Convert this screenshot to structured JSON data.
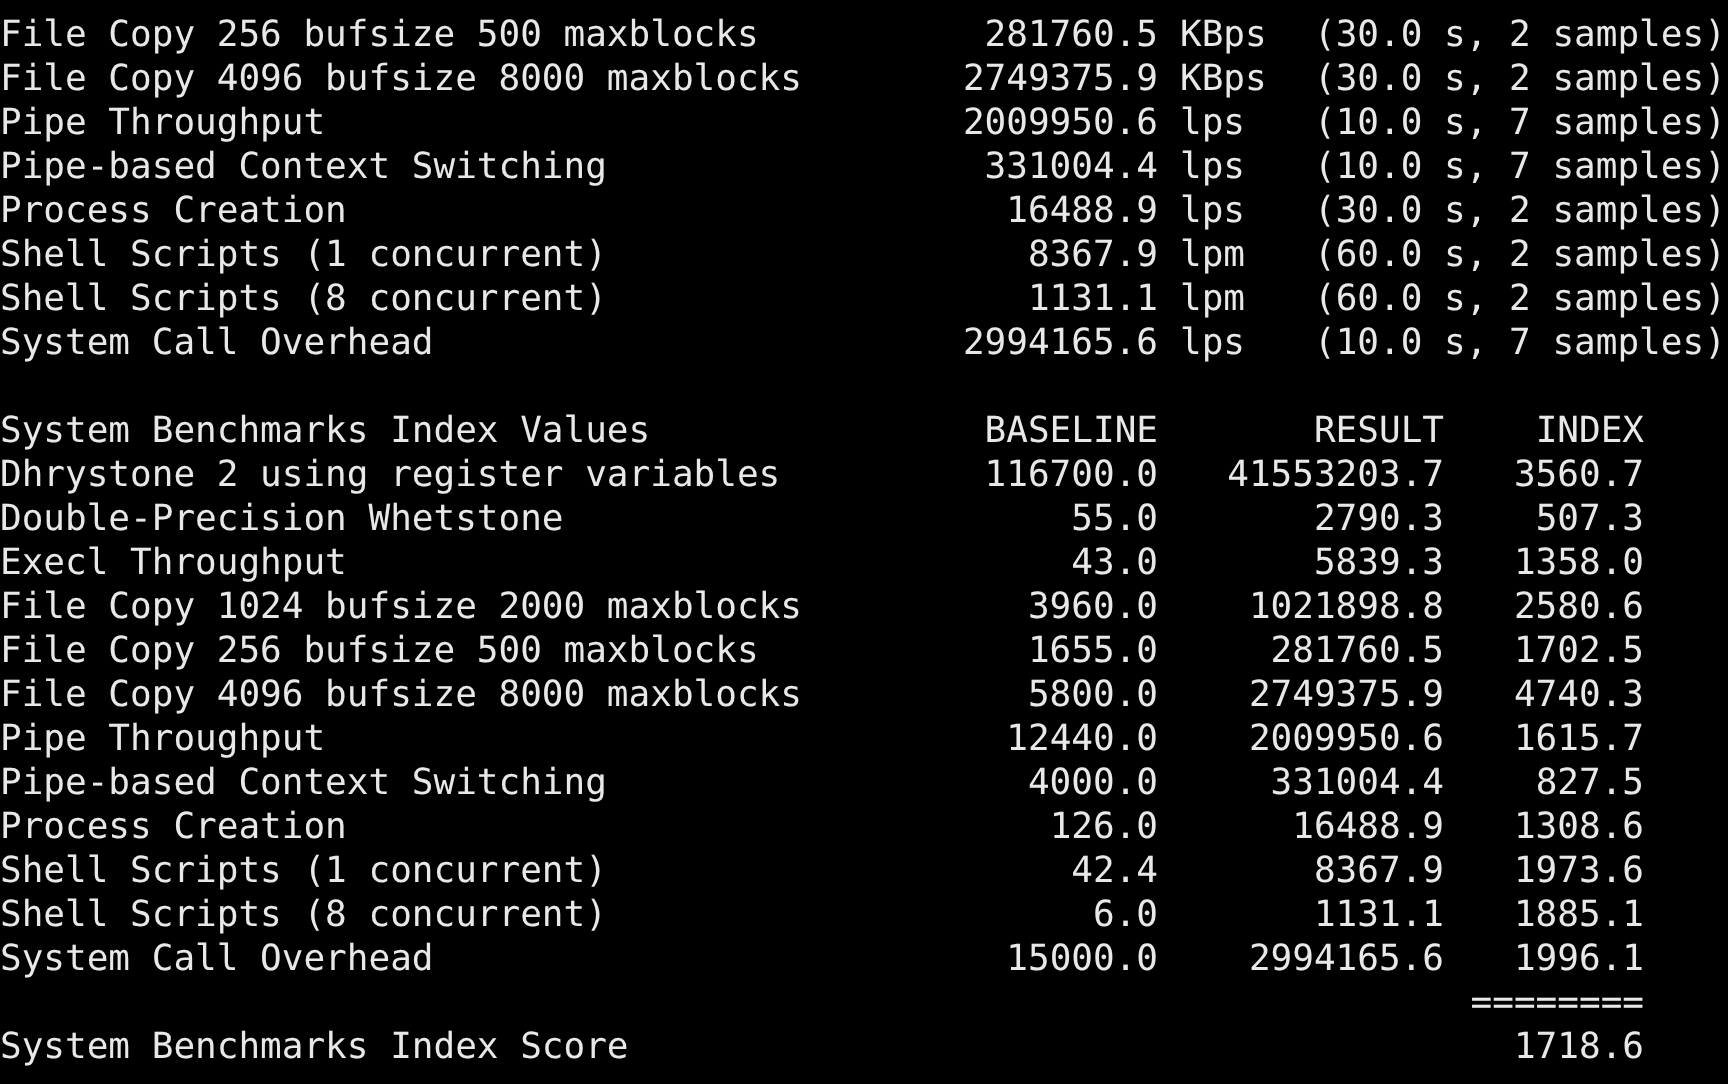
{
  "runs": [
    {
      "name": "File Copy 256 bufsize 500 maxblocks",
      "value": "281760.5",
      "unit": "KBps",
      "timing": "(30.0 s, 2 samples)"
    },
    {
      "name": "File Copy 4096 bufsize 8000 maxblocks",
      "value": "2749375.9",
      "unit": "KBps",
      "timing": "(30.0 s, 2 samples)"
    },
    {
      "name": "Pipe Throughput",
      "value": "2009950.6",
      "unit": "lps",
      "timing": "(10.0 s, 7 samples)"
    },
    {
      "name": "Pipe-based Context Switching",
      "value": "331004.4",
      "unit": "lps",
      "timing": "(10.0 s, 7 samples)"
    },
    {
      "name": "Process Creation",
      "value": "16488.9",
      "unit": "lps",
      "timing": "(30.0 s, 2 samples)"
    },
    {
      "name": "Shell Scripts (1 concurrent)",
      "value": "8367.9",
      "unit": "lpm",
      "timing": "(60.0 s, 2 samples)"
    },
    {
      "name": "Shell Scripts (8 concurrent)",
      "value": "1131.1",
      "unit": "lpm",
      "timing": "(60.0 s, 2 samples)"
    },
    {
      "name": "System Call Overhead",
      "value": "2994165.6",
      "unit": "lps",
      "timing": "(10.0 s, 7 samples)"
    }
  ],
  "index_table": {
    "title": "System Benchmarks Index Values",
    "columns": [
      "BASELINE",
      "RESULT",
      "INDEX"
    ],
    "rows": [
      {
        "name": "Dhrystone 2 using register variables",
        "baseline": "116700.0",
        "result": "41553203.7",
        "index": "3560.7"
      },
      {
        "name": "Double-Precision Whetstone",
        "baseline": "55.0",
        "result": "2790.3",
        "index": "507.3"
      },
      {
        "name": "Execl Throughput",
        "baseline": "43.0",
        "result": "5839.3",
        "index": "1358.0"
      },
      {
        "name": "File Copy 1024 bufsize 2000 maxblocks",
        "baseline": "3960.0",
        "result": "1021898.8",
        "index": "2580.6"
      },
      {
        "name": "File Copy 256 bufsize 500 maxblocks",
        "baseline": "1655.0",
        "result": "281760.5",
        "index": "1702.5"
      },
      {
        "name": "File Copy 4096 bufsize 8000 maxblocks",
        "baseline": "5800.0",
        "result": "2749375.9",
        "index": "4740.3"
      },
      {
        "name": "Pipe Throughput",
        "baseline": "12440.0",
        "result": "2009950.6",
        "index": "1615.7"
      },
      {
        "name": "Pipe-based Context Switching",
        "baseline": "4000.0",
        "result": "331004.4",
        "index": "827.5"
      },
      {
        "name": "Process Creation",
        "baseline": "126.0",
        "result": "16488.9",
        "index": "1308.6"
      },
      {
        "name": "Shell Scripts (1 concurrent)",
        "baseline": "42.4",
        "result": "8367.9",
        "index": "1973.6"
      },
      {
        "name": "Shell Scripts (8 concurrent)",
        "baseline": "6.0",
        "result": "1131.1",
        "index": "1885.1"
      },
      {
        "name": "System Call Overhead",
        "baseline": "15000.0",
        "result": "2994165.6",
        "index": "1996.1"
      }
    ],
    "separator": "========",
    "score": {
      "label": "System Benchmarks Index Score",
      "value": "1718.6"
    }
  }
}
